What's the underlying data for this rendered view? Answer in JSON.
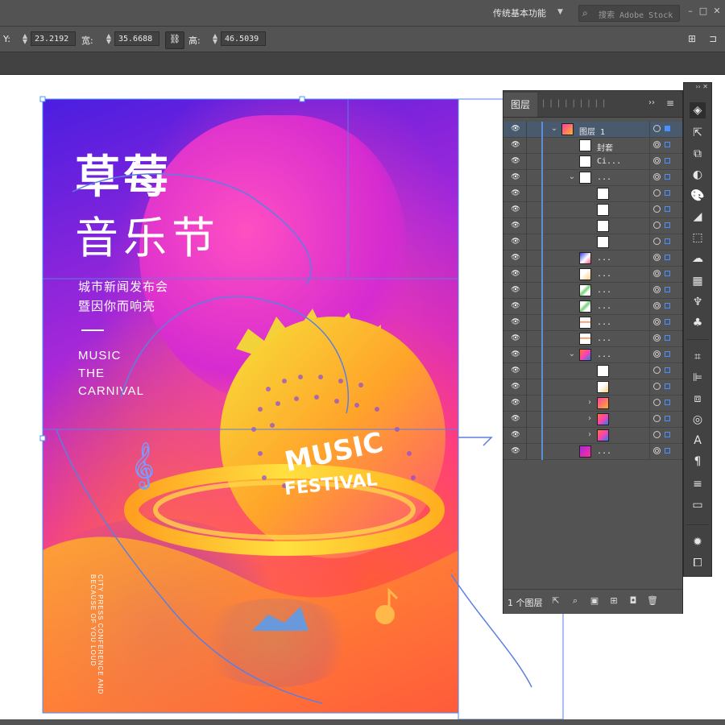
{
  "topbar": {
    "workspace": "传统基本功能",
    "search_placeholder": "搜索 Adobe Stock"
  },
  "controlbar": {
    "y_label": "Y:",
    "y_value": "23.2192",
    "w_label": "宽:",
    "w_value": "35.6688",
    "h_label": "高:",
    "h_value": "46.5039"
  },
  "poster": {
    "title_line1": "草莓",
    "title_line2": "音乐节",
    "subtitle_line1": "城市新闻发布会",
    "subtitle_line2": "暨因你而响亮",
    "eng_line1": "MUSIC",
    "eng_line2": "THE",
    "eng_line3": "CARNIVAL",
    "vertical_text": "CITY PRESS CONFERENCE AND BECAUSE OF YOU LOUD",
    "logo_text_1": "MUSIC",
    "logo_text_2": "FESTIVAL"
  },
  "layers_panel": {
    "tab_label": "图层",
    "more": "››",
    "footer_label": "1 个图层",
    "rows": [
      {
        "label": "图层 1",
        "indent": 0,
        "twirl": "open",
        "thumb": "grad",
        "selected": true
      },
      {
        "label": "封套",
        "indent": 1,
        "twirl": "none",
        "thumb": "white"
      },
      {
        "label": "Ci...",
        "indent": 1,
        "twirl": "none",
        "thumb": "white"
      },
      {
        "label": "...",
        "indent": 1,
        "twirl": "open",
        "thumb": "white"
      },
      {
        "label": "",
        "indent": 2,
        "twirl": "none",
        "thumb": "white"
      },
      {
        "label": "",
        "indent": 2,
        "twirl": "none",
        "thumb": "white"
      },
      {
        "label": "",
        "indent": 2,
        "twirl": "none",
        "thumb": "white"
      },
      {
        "label": "",
        "indent": 2,
        "twirl": "none",
        "thumb": "white"
      },
      {
        "label": "...",
        "indent": 1,
        "twirl": "none",
        "thumb": "grad2"
      },
      {
        "label": "...",
        "indent": 1,
        "twirl": "none",
        "thumb": "light"
      },
      {
        "label": "...",
        "indent": 1,
        "twirl": "none",
        "thumb": "green"
      },
      {
        "label": "...",
        "indent": 1,
        "twirl": "none",
        "thumb": "green"
      },
      {
        "label": "...",
        "indent": 1,
        "twirl": "none",
        "thumb": "gline"
      },
      {
        "label": "...",
        "indent": 1,
        "twirl": "none",
        "thumb": "gline"
      },
      {
        "label": "...",
        "indent": 1,
        "twirl": "open",
        "thumb": "grad3"
      },
      {
        "label": "",
        "indent": 2,
        "twirl": "none",
        "thumb": "white"
      },
      {
        "label": "",
        "indent": 2,
        "twirl": "none",
        "thumb": "light"
      },
      {
        "label": "",
        "indent": 2,
        "twirl": "closed",
        "thumb": "grad"
      },
      {
        "label": "",
        "indent": 2,
        "twirl": "closed",
        "thumb": "grad3"
      },
      {
        "label": "",
        "indent": 2,
        "twirl": "closed",
        "thumb": "grad3"
      },
      {
        "label": "...",
        "indent": 1,
        "twirl": "none",
        "thumb": "grad4"
      }
    ]
  },
  "colors": {
    "selection_blue": "#4a90ff",
    "outline_blue": "#5b7fe0",
    "panel_bg": "#535353",
    "ui_dark": "#424242"
  },
  "dock_icons": [
    "layers-icon",
    "export-icon",
    "transform-icon",
    "opacity-icon",
    "palette-icon",
    "gradient-icon",
    "3d-icon",
    "cc-libraries-icon",
    "grid-icon",
    "puppet-icon",
    "club-icon",
    "align-icon",
    "align-left-icon",
    "pathfinder-icon",
    "appearance-icon",
    "character-icon",
    "paragraph-icon",
    "stroke-icon",
    "swatch-icon",
    "brightness-icon",
    "artboard-icon"
  ]
}
